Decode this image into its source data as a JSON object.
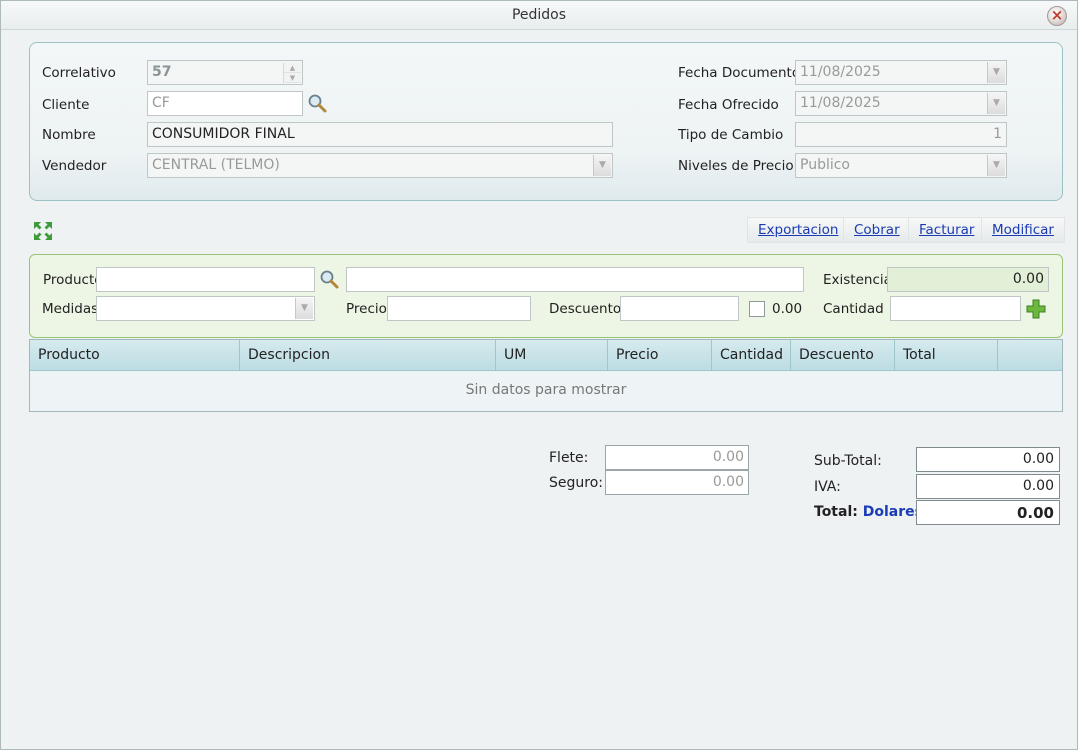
{
  "window": {
    "title": "Pedidos"
  },
  "header": {
    "correlativo_label": "Correlativo",
    "correlativo_value": "57",
    "cliente_label": "Cliente",
    "cliente_value": "CF",
    "nombre_label": "Nombre",
    "nombre_value": "CONSUMIDOR FINAL",
    "vendedor_label": "Vendedor",
    "vendedor_value": "CENTRAL (TELMO)",
    "fecha_documento_label": "Fecha Documento",
    "fecha_documento_value": "11/08/2025",
    "fecha_ofrecido_label": "Fecha Ofrecido",
    "fecha_ofrecido_value": "11/08/2025",
    "tipo_cambio_label": "Tipo de Cambio",
    "tipo_cambio_value": "1",
    "niveles_precio_label": "Niveles de Precio",
    "niveles_precio_value": "Publico"
  },
  "toolbar": {
    "exportacion": "Exportacion",
    "cobrar": "Cobrar",
    "facturar": "Facturar",
    "modificar": "Modificar"
  },
  "product_entry": {
    "producto_label": "Producto",
    "producto_value": "",
    "descripcion_value": "",
    "existencia_label": "Existencia",
    "existencia_value": "0.00",
    "medidas_label": "Medidas",
    "medidas_value": "",
    "precio_label": "Precio",
    "precio_value": "",
    "descuento_label": "Descuento",
    "descuento_value": "",
    "descuento_pct": "0.00",
    "cantidad_label": "Cantidad",
    "cantidad_value": ""
  },
  "grid": {
    "columns": [
      "Producto",
      "Descripcion",
      "UM",
      "Precio",
      "Cantidad",
      "Descuento",
      "Total"
    ],
    "empty_text": "Sin datos para mostrar"
  },
  "totals": {
    "flete_label": "Flete:",
    "flete_value": "0.00",
    "seguro_label": "Seguro:",
    "seguro_value": "0.00",
    "subtotal_label": "Sub-Total:",
    "subtotal_value": "0.00",
    "iva_label": "IVA:",
    "iva_value": "0.00",
    "total_label": "Total:",
    "currency": "Dolares",
    "total_value": "0.00"
  },
  "colors": {
    "accent_link": "#1a3bb3",
    "currency": "#1a3bb3",
    "add_icon": "#5aa531"
  },
  "icons": {
    "close": "close-icon",
    "search": "search-icon",
    "expand": "expand-icon",
    "add": "plus-icon"
  }
}
